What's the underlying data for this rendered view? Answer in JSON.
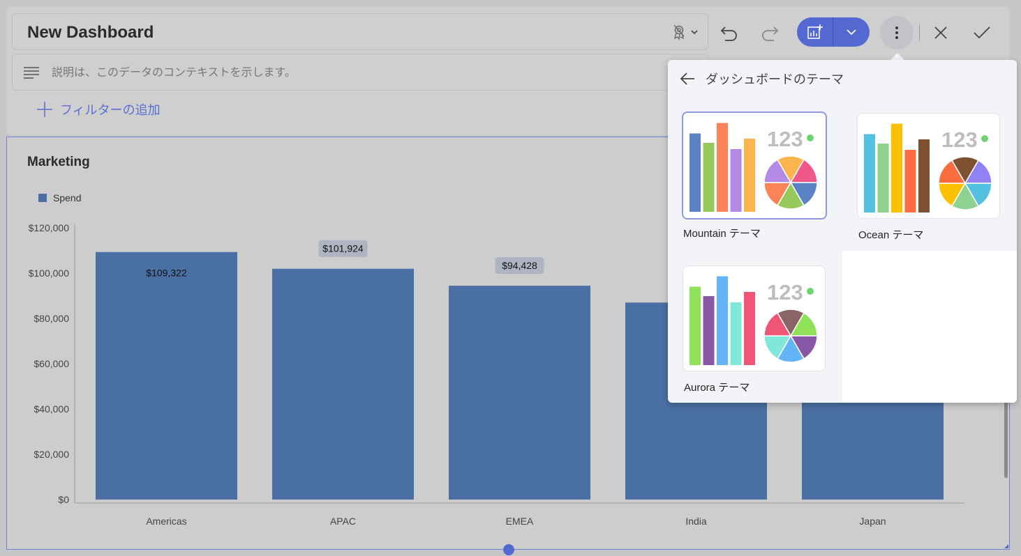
{
  "header": {
    "title": "New Dashboard",
    "description_placeholder": "説明は、このデータのコンテキストを示します。",
    "add_filter_label": "フィルターの追加"
  },
  "toolbar": {
    "icons": [
      "theme-award-icon",
      "undo-icon",
      "redo-icon",
      "add-visualization-icon",
      "chevron-down-icon",
      "more-vert-icon",
      "close-icon",
      "check-icon"
    ]
  },
  "widget": {
    "title": "Marketing",
    "legend_label": "Spend"
  },
  "chart_data": {
    "type": "bar",
    "title": "Marketing",
    "categories": [
      "Americas",
      "APAC",
      "EMEA",
      "India",
      "Japan"
    ],
    "series": [
      {
        "name": "Spend",
        "values": [
          109322,
          101924,
          94428,
          87000,
          87000
        ],
        "color": "#4a6fa3"
      }
    ],
    "data_labels": [
      "$109,322",
      "$101,924",
      "$94,428"
    ],
    "y_ticks": [
      "$0",
      "$20,000",
      "$40,000",
      "$60,000",
      "$80,000",
      "$100,000",
      "$120,000"
    ],
    "ylim": [
      0,
      120000
    ],
    "legend_position": "top-left",
    "grid": false
  },
  "theme_popup": {
    "title": "ダッシュボードのテーマ",
    "themes": [
      {
        "label": "Mountain テーマ",
        "selected": true,
        "number": "123",
        "dot_color": "#6fd46f",
        "bars": [
          {
            "h": 0.75,
            "c": "#5a82c4"
          },
          {
            "h": 0.66,
            "c": "#98c95d"
          },
          {
            "h": 0.85,
            "c": "#fb8355"
          },
          {
            "h": 0.6,
            "c": "#b28ae5"
          },
          {
            "h": 0.7,
            "c": "#fbb54c"
          }
        ],
        "pie": [
          "#fbb54c",
          "#f0578a",
          "#5a82c4",
          "#98c95d",
          "#fb8355",
          "#b28ae5"
        ]
      },
      {
        "label": "Ocean テーマ",
        "selected": false,
        "number": "123",
        "dot_color": "#6fd46f",
        "bars": [
          {
            "h": 0.75,
            "c": "#54c1e0"
          },
          {
            "h": 0.66,
            "c": "#8fd18f"
          },
          {
            "h": 0.85,
            "c": "#fcc100"
          },
          {
            "h": 0.6,
            "c": "#fb6c3e"
          },
          {
            "h": 0.7,
            "c": "#7e5231"
          }
        ],
        "pie": [
          "#7e5231",
          "#9081f5",
          "#54c1e0",
          "#8fd18f",
          "#fcc100",
          "#fb6c3e"
        ]
      },
      {
        "label": "Aurora テーマ",
        "selected": false,
        "number": "123",
        "dot_color": "#6fd46f",
        "bars": [
          {
            "h": 0.75,
            "c": "#8ee158"
          },
          {
            "h": 0.66,
            "c": "#8957a5"
          },
          {
            "h": 0.85,
            "c": "#63b5f7"
          },
          {
            "h": 0.6,
            "c": "#80e8d8"
          },
          {
            "h": 0.7,
            "c": "#ef5676"
          }
        ],
        "pie": [
          "#8b6565",
          "#8ee158",
          "#8957a5",
          "#63b5f7",
          "#80e8d8",
          "#ef5676"
        ]
      }
    ]
  }
}
